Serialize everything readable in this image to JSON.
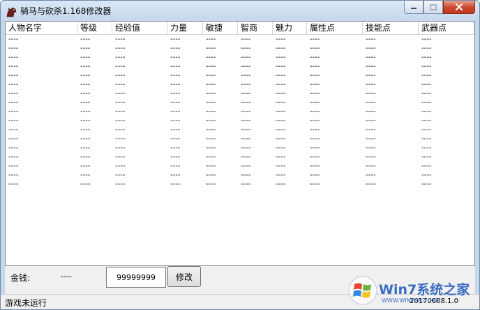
{
  "window": {
    "title": "骑马与砍杀1.168修改器"
  },
  "table": {
    "columns": [
      "人物名字",
      "等级",
      "经验值",
      "力量",
      "敏捷",
      "智商",
      "魅力",
      "属性点",
      "技能点",
      "武器点"
    ],
    "rows": [
      [
        "----",
        "----",
        "----",
        "----",
        "----",
        "----",
        "----",
        "----",
        "----",
        "----"
      ],
      [
        "----",
        "----",
        "----",
        "----",
        "----",
        "----",
        "----",
        "----",
        "----",
        "----"
      ],
      [
        "----",
        "----",
        "----",
        "----",
        "----",
        "----",
        "----",
        "----",
        "----",
        "----"
      ],
      [
        "----",
        "----",
        "----",
        "----",
        "----",
        "----",
        "----",
        "----",
        "----",
        "----"
      ],
      [
        "----",
        "----",
        "----",
        "----",
        "----",
        "----",
        "----",
        "----",
        "----",
        "----"
      ],
      [
        "----",
        "----",
        "----",
        "----",
        "----",
        "----",
        "----",
        "----",
        "----",
        "----"
      ],
      [
        "----",
        "----",
        "----",
        "----",
        "----",
        "----",
        "----",
        "----",
        "----",
        "----"
      ],
      [
        "----",
        "----",
        "----",
        "----",
        "----",
        "----",
        "----",
        "----",
        "----",
        "----"
      ],
      [
        "----",
        "----",
        "----",
        "----",
        "----",
        "----",
        "----",
        "----",
        "----",
        "----"
      ],
      [
        "----",
        "----",
        "----",
        "----",
        "----",
        "----",
        "----",
        "----",
        "----",
        "----"
      ],
      [
        "----",
        "----",
        "----",
        "----",
        "----",
        "----",
        "----",
        "----",
        "----",
        "----"
      ],
      [
        "----",
        "----",
        "----",
        "----",
        "----",
        "----",
        "----",
        "----",
        "----",
        "----"
      ],
      [
        "----",
        "----",
        "----",
        "----",
        "----",
        "----",
        "----",
        "----",
        "----",
        "----"
      ],
      [
        "----",
        "----",
        "----",
        "----",
        "----",
        "----",
        "----",
        "----",
        "----",
        "----"
      ],
      [
        "----",
        "----",
        "----",
        "----",
        "----",
        "----",
        "----",
        "----",
        "----",
        "----"
      ],
      [
        "----",
        "----",
        "----",
        "----",
        "----",
        "----",
        "----",
        "----",
        "----",
        "----"
      ],
      [
        "----",
        "----",
        "----",
        "----",
        "----",
        "----",
        "----",
        "----",
        "----",
        "----"
      ]
    ]
  },
  "money": {
    "label": "金钱:",
    "current": "----",
    "input_value": "99999999",
    "modify_label": "修改"
  },
  "status": {
    "text": "游戏未运行",
    "version": "20170608.1.0"
  },
  "watermark": {
    "text": "Win7系统之家",
    "sub": "WWW.WINWIN7.COM"
  },
  "icons": {
    "app": "horse-icon",
    "minimize": "minimize-icon",
    "maximize": "maximize-icon",
    "close": "close-icon",
    "watermark_logo": "windows-logo-icon"
  },
  "colors": {
    "title_gradient_top": "#dbe7f5",
    "title_gradient_bottom": "#c6d7ec",
    "close_button": "#c9452c",
    "watermark_blue": "#3a6cc0"
  }
}
